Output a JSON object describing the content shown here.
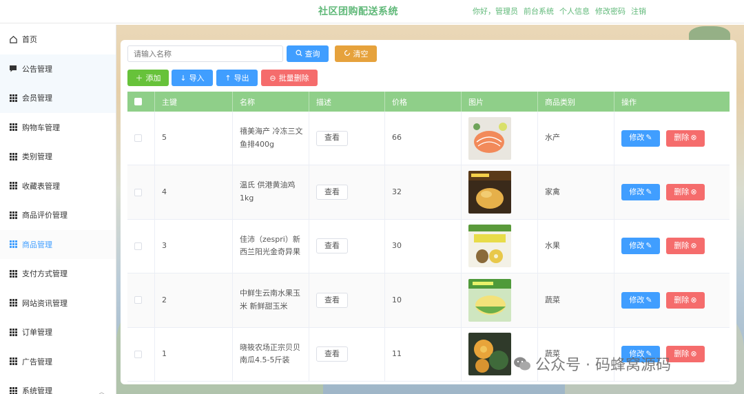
{
  "header": {
    "title": "社区团购配送系统",
    "links": [
      "你好，管理员",
      "前台系统",
      "个人信息",
      "修改密码",
      "注销"
    ]
  },
  "sidebar": {
    "items": [
      {
        "label": "首页",
        "icon": "home-icon"
      },
      {
        "label": "公告管理",
        "icon": "message-icon"
      },
      {
        "label": "会员管理",
        "icon": "grid-icon"
      },
      {
        "label": "购物车管理",
        "icon": "grid-icon"
      },
      {
        "label": "类别管理",
        "icon": "grid-icon"
      },
      {
        "label": "收藏表管理",
        "icon": "grid-icon"
      },
      {
        "label": "商品评价管理",
        "icon": "grid-icon"
      },
      {
        "label": "商品管理",
        "icon": "grid-icon",
        "active": true
      },
      {
        "label": "支付方式管理",
        "icon": "grid-icon"
      },
      {
        "label": "网站资讯管理",
        "icon": "grid-icon"
      },
      {
        "label": "订单管理",
        "icon": "grid-icon"
      },
      {
        "label": "广告管理",
        "icon": "grid-icon"
      },
      {
        "label": "系统管理",
        "icon": "grid-icon",
        "expandable": true
      }
    ]
  },
  "search": {
    "placeholder": "请输入名称",
    "query_label": "查询",
    "clear_label": "清空"
  },
  "toolbar": {
    "add_label": "添加",
    "import_label": "导入",
    "export_label": "导出",
    "batch_delete_label": "批量删除"
  },
  "table": {
    "columns": [
      "主键",
      "名称",
      "描述",
      "价格",
      "图片",
      "商品类别",
      "操作"
    ],
    "view_label": "查看",
    "edit_label": "修改",
    "delete_label": "删除",
    "rows": [
      {
        "id": "5",
        "name": "禧美海产 冷冻三文鱼排400g",
        "price": "66",
        "category": "水产",
        "image": "salmon"
      },
      {
        "id": "4",
        "name": "温氏 供港黄油鸡1kg",
        "price": "32",
        "category": "家禽",
        "image": "chicken"
      },
      {
        "id": "3",
        "name": "佳沛（zespri）新西兰阳光金奇异果",
        "price": "30",
        "category": "水果",
        "image": "kiwi"
      },
      {
        "id": "2",
        "name": "中鲜生云南水果玉米 新鲜甜玉米",
        "price": "10",
        "category": "蔬菜",
        "image": "corn"
      },
      {
        "id": "1",
        "name": "晓筱农场正宗贝贝南瓜4.5-5斤装",
        "price": "11",
        "category": "蔬菜",
        "image": "pumpkin"
      }
    ]
  },
  "watermark": "公众号 · 码蜂窝源码",
  "colors": {
    "accent": "#409eff",
    "header_green": "#5fb878",
    "table_header": "#8fcf89",
    "danger": "#f56c6c",
    "success": "#67c23a",
    "warning": "#e6a23c"
  }
}
